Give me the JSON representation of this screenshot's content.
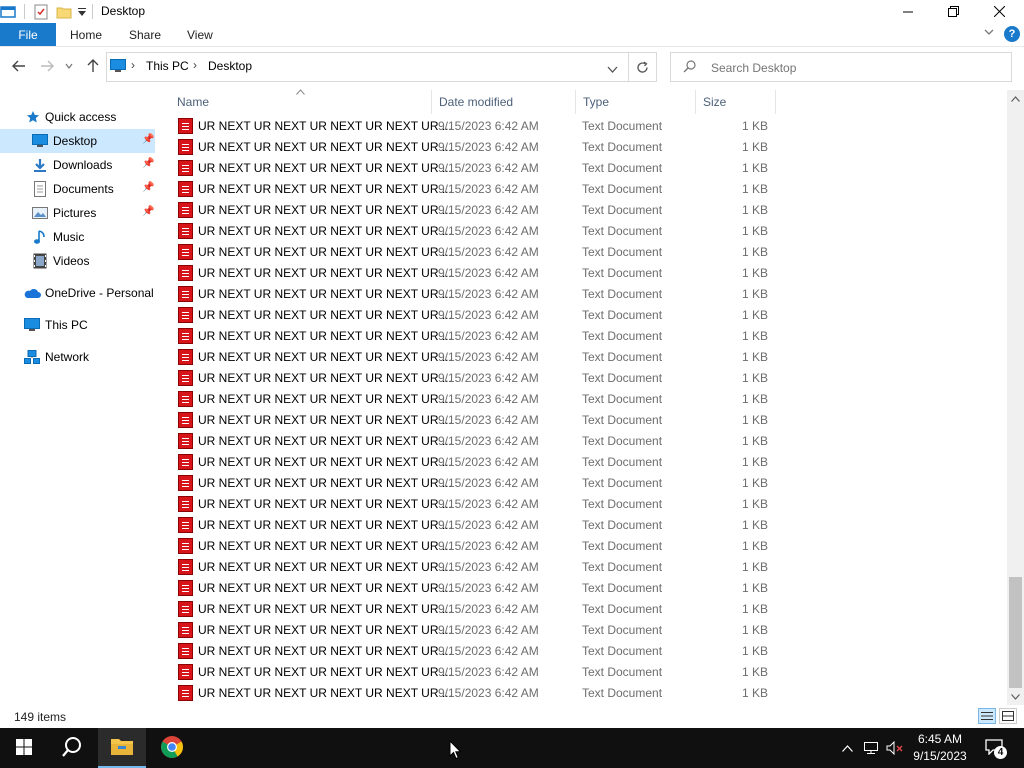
{
  "window": {
    "title": "Desktop",
    "icons": [
      "explorer-icon",
      "properties-icon",
      "new-folder-icon",
      "quick-access-dropdown-icon"
    ]
  },
  "ribbon": {
    "file": "File",
    "tabs": [
      "Home",
      "Share",
      "View"
    ]
  },
  "address": {
    "breadcrumbs": [
      "This PC",
      "Desktop"
    ]
  },
  "search": {
    "placeholder": "Search Desktop"
  },
  "nav": {
    "items": [
      {
        "label": "Quick access",
        "icon": "star-icon",
        "pinned": false
      },
      {
        "label": "Desktop",
        "icon": "desktop-icon",
        "pinned": true,
        "selected": true
      },
      {
        "label": "Downloads",
        "icon": "downloads-icon",
        "pinned": true
      },
      {
        "label": "Documents",
        "icon": "documents-icon",
        "pinned": true
      },
      {
        "label": "Pictures",
        "icon": "pictures-icon",
        "pinned": true
      },
      {
        "label": "Music",
        "icon": "music-icon",
        "pinned": false
      },
      {
        "label": "Videos",
        "icon": "videos-icon",
        "pinned": false
      },
      {
        "label": "OneDrive - Personal",
        "icon": "onedrive-icon",
        "pinned": false
      },
      {
        "label": "This PC",
        "icon": "this-pc-icon",
        "pinned": false
      },
      {
        "label": "Network",
        "icon": "network-icon",
        "pinned": false
      }
    ]
  },
  "columns": {
    "name": "Name",
    "date": "Date modified",
    "type": "Type",
    "size": "Size"
  },
  "files": {
    "name": "UR NEXT UR NEXT UR NEXT UR NEXT UR ...",
    "date": "9/15/2023 6:42 AM",
    "type": "Text Document",
    "size": "1 KB",
    "visible_rows": 28
  },
  "status": {
    "count": "149 items"
  },
  "taskbar": {
    "apps": [
      "start-icon",
      "search-icon",
      "file-explorer-icon",
      "chrome-icon"
    ],
    "time": "6:45 AM",
    "date": "9/15/2023",
    "notification_count": "4"
  }
}
